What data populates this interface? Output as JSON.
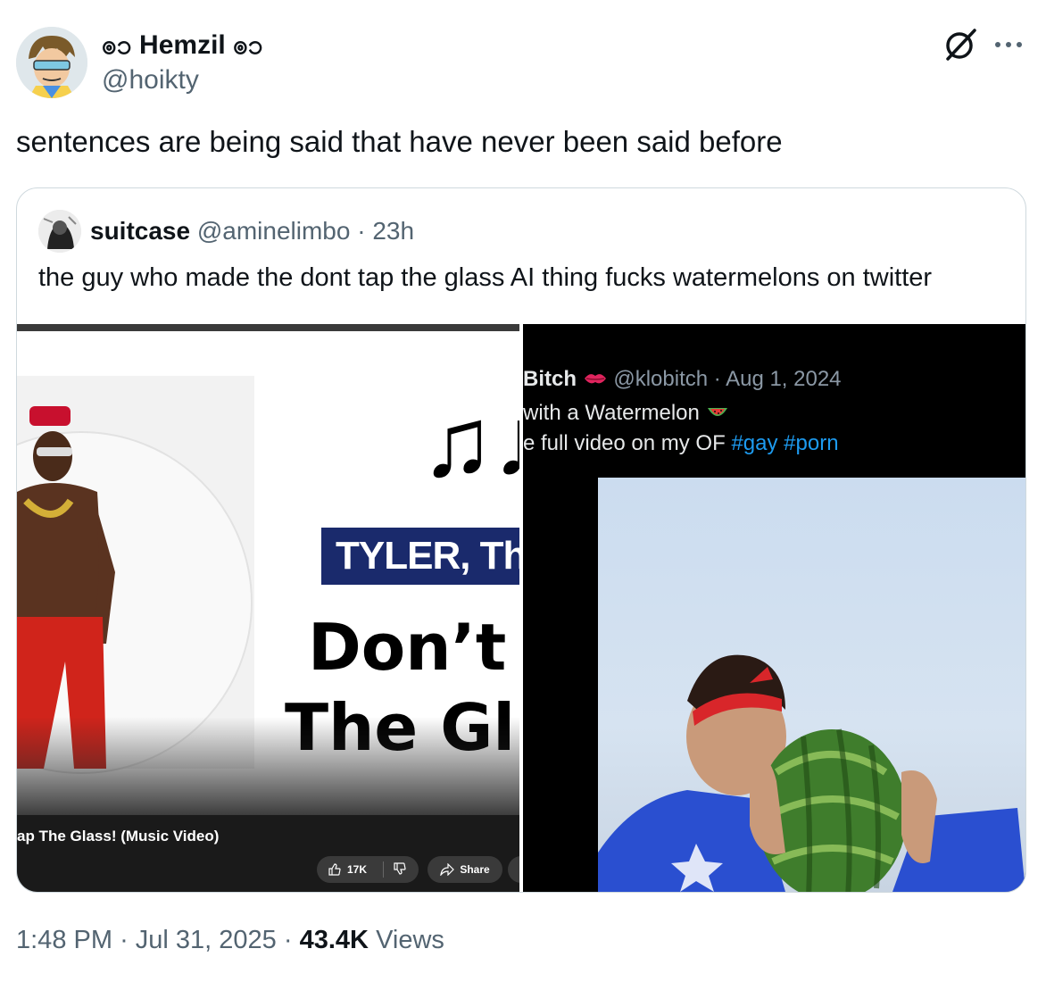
{
  "tweet": {
    "display_name": "ၜၥ Hemzil ၜၥ",
    "handle": "@hoikty",
    "text": "sentences are being said that have never been said before",
    "time": "1:48 PM",
    "date": "Jul 31, 2025",
    "views_count": "43.4K",
    "views_label": "Views",
    "sep": "·"
  },
  "quote": {
    "name": "suitcase",
    "handle": "@aminelimbo",
    "time": "23h",
    "sep": "·",
    "text": "the guy who made the dont tap the glass AI thing fucks watermelons on twitter"
  },
  "media_left": {
    "notes": "♫♪",
    "banner": "TYLER, The C",
    "big_line1": "Don’t T",
    "big_line2": "The Gl",
    "video_title": "ap The Glass! (Music Video)",
    "like_count": "17K",
    "share_label": "Share"
  },
  "media_right": {
    "name": "Bitch",
    "handle_date": "@klobitch · Aug 1, 2024",
    "line2": "with a Watermelon",
    "line3_text": "e full video on my OF",
    "tag1": "#gay",
    "tag2": "#porn"
  },
  "icons": {
    "grok": "grok-icon",
    "more": "more-icon",
    "kiss": "kiss-icon",
    "watermelon": "watermelon-icon"
  }
}
